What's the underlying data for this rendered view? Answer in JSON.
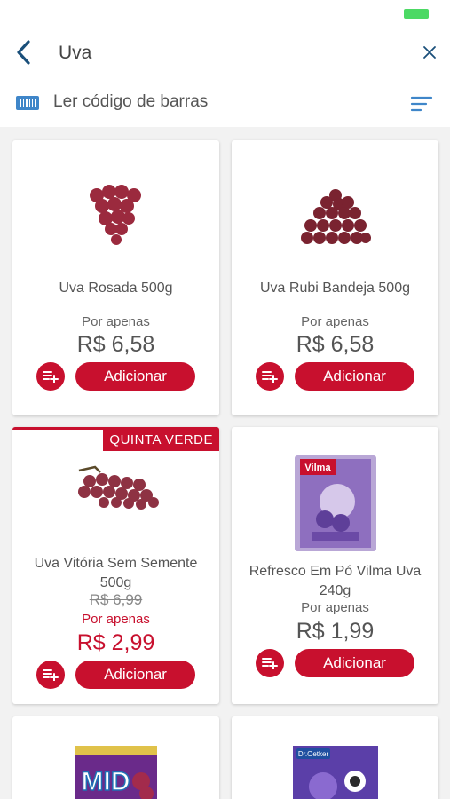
{
  "search": {
    "query": "Uva"
  },
  "barcode": {
    "label": "Ler código de barras"
  },
  "colors": {
    "brand_red": "#c8102e",
    "nav_blue": "#1a4f7a",
    "battery_green": "#4cd964"
  },
  "products": [
    {
      "name": "Uva Rosada 500g",
      "por_label": "Por apenas",
      "price": "R$ 6,58",
      "add_label": "Adicionar"
    },
    {
      "name": "Uva Rubi Bandeja 500g",
      "por_label": "Por apenas",
      "price": "R$ 6,58",
      "add_label": "Adicionar"
    },
    {
      "badge": "QUINTA VERDE",
      "name": "Uva Vitória Sem Semente 500g",
      "old_price": "R$ 6,99",
      "por_label": "Por apenas",
      "price": "R$ 2,99",
      "add_label": "Adicionar"
    },
    {
      "name": "Refresco Em Pó Vilma Uva 240g",
      "por_label": "Por apenas",
      "price": "R$ 1,99",
      "add_label": "Adicionar",
      "package_brand": "Vilma"
    },
    {
      "package_brand": "MID"
    },
    {
      "package_brand": "Dr.Oetker"
    }
  ]
}
